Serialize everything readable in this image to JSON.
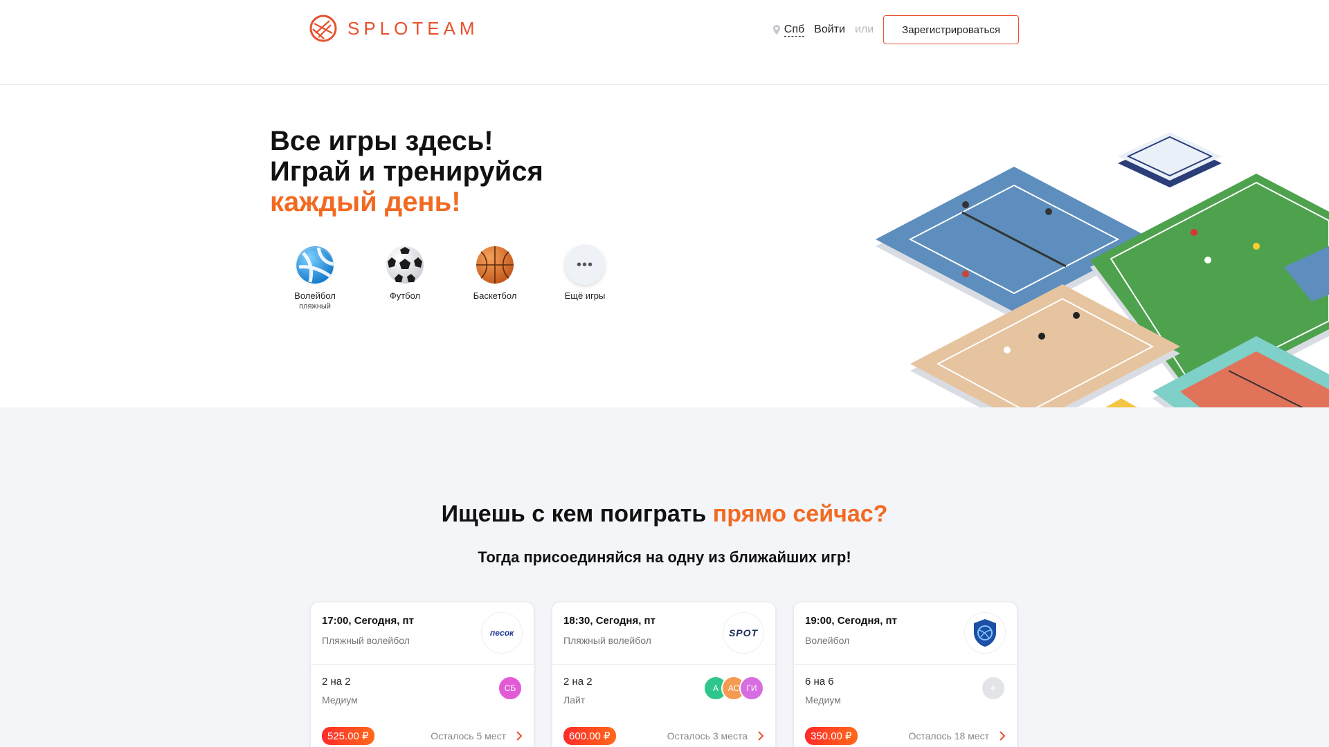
{
  "header": {
    "logo_text": "SPLOTEAM",
    "city": "Спб",
    "login": "Войти",
    "or": "или",
    "register": "Зарегистрироваться"
  },
  "hero": {
    "title_line1": "Все игры здесь!",
    "title_line2": "Играй и тренируйся",
    "title_accent": "каждый день!",
    "sports": [
      {
        "label": "Волейбол",
        "sub": "пляжный",
        "icon": "volleyball-icon"
      },
      {
        "label": "Футбол",
        "sub": "",
        "icon": "soccer-ball-icon"
      },
      {
        "label": "Баскетбол",
        "sub": "",
        "icon": "basketball-icon"
      },
      {
        "label": "Ещё игры",
        "sub": "",
        "icon": "more-dots-icon",
        "dots": "•••"
      }
    ]
  },
  "lower": {
    "title_main": "Ищешь с кем поиграть ",
    "title_accent": "прямо сейчас?",
    "subtitle": "Тогда присоединяйся на одну из ближайших игр!"
  },
  "games": [
    {
      "time": "17:00, Сегодня, пт",
      "sport": "Пляжный волейбол",
      "venue_logo_text": "песок",
      "format": "2 на 2",
      "level": "Медиум",
      "avatars": [
        {
          "initials": "СБ",
          "color": "#e35ad7"
        }
      ],
      "price": "525.00 ₽",
      "seats": "Осталось 5 мест"
    },
    {
      "time": "18:30, Сегодня, пт",
      "sport": "Пляжный волейбол",
      "venue_logo_text": "SPOT",
      "format": "2 на 2",
      "level": "Лайт",
      "avatars": [
        {
          "initials": "А",
          "color": "#2fc68b"
        },
        {
          "initials": "АС",
          "color": "#f59a52"
        },
        {
          "initials": "ГИ",
          "color": "#d86de1"
        }
      ],
      "price": "600.00 ₽",
      "seats": "Осталось 3 места"
    },
    {
      "time": "19:00, Сегодня, пт",
      "sport": "Волейбол",
      "venue_logo_text": "",
      "format": "6 на 6",
      "level": "Медиум",
      "avatars": [
        {
          "initials": "+",
          "color": "#e2e4e8"
        }
      ],
      "price": "350.00 ₽",
      "seats": "Осталось 18 мест"
    }
  ],
  "colors": {
    "brand": "#e8512d",
    "accent": "#f26a22",
    "price_gradient_start": "#ff2a2a",
    "price_gradient_end": "#ff6a1a"
  }
}
